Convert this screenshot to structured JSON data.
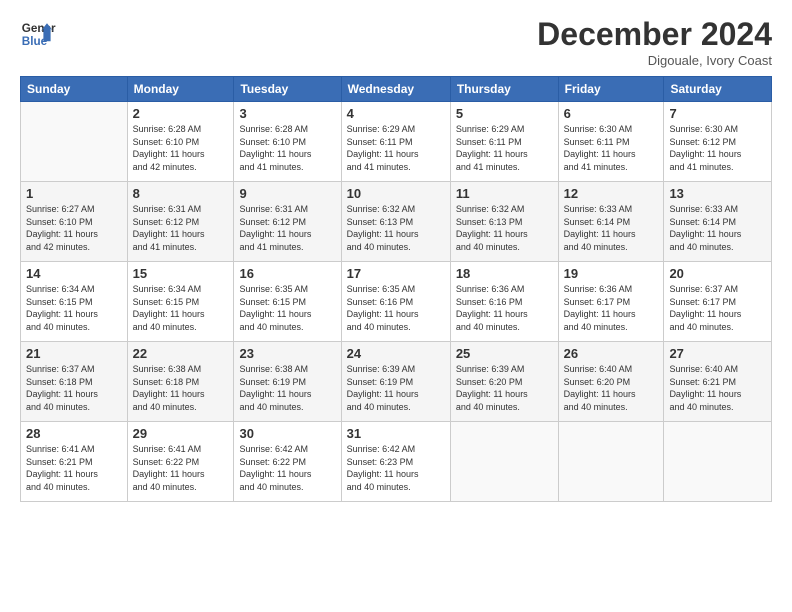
{
  "header": {
    "logo_line1": "General",
    "logo_line2": "Blue",
    "month_title": "December 2024",
    "location": "Digouale, Ivory Coast"
  },
  "calendar": {
    "headers": [
      "Sunday",
      "Monday",
      "Tuesday",
      "Wednesday",
      "Thursday",
      "Friday",
      "Saturday"
    ],
    "weeks": [
      [
        {
          "day": "",
          "info": ""
        },
        {
          "day": "2",
          "info": "Sunrise: 6:28 AM\nSunset: 6:10 PM\nDaylight: 11 hours\nand 42 minutes."
        },
        {
          "day": "3",
          "info": "Sunrise: 6:28 AM\nSunset: 6:10 PM\nDaylight: 11 hours\nand 41 minutes."
        },
        {
          "day": "4",
          "info": "Sunrise: 6:29 AM\nSunset: 6:11 PM\nDaylight: 11 hours\nand 41 minutes."
        },
        {
          "day": "5",
          "info": "Sunrise: 6:29 AM\nSunset: 6:11 PM\nDaylight: 11 hours\nand 41 minutes."
        },
        {
          "day": "6",
          "info": "Sunrise: 6:30 AM\nSunset: 6:11 PM\nDaylight: 11 hours\nand 41 minutes."
        },
        {
          "day": "7",
          "info": "Sunrise: 6:30 AM\nSunset: 6:12 PM\nDaylight: 11 hours\nand 41 minutes."
        }
      ],
      [
        {
          "day": "1",
          "info": "Sunrise: 6:27 AM\nSunset: 6:10 PM\nDaylight: 11 hours\nand 42 minutes."
        },
        {
          "day": "",
          "info": ""
        },
        {
          "day": "",
          "info": ""
        },
        {
          "day": "",
          "info": ""
        },
        {
          "day": "",
          "info": ""
        },
        {
          "day": "",
          "info": ""
        },
        {
          "day": "",
          "info": ""
        }
      ],
      [
        {
          "day": "8",
          "info": "Sunrise: 6:31 AM\nSunset: 6:12 PM\nDaylight: 11 hours\nand 41 minutes."
        },
        {
          "day": "9",
          "info": "Sunrise: 6:31 AM\nSunset: 6:12 PM\nDaylight: 11 hours\nand 41 minutes."
        },
        {
          "day": "10",
          "info": "Sunrise: 6:32 AM\nSunset: 6:13 PM\nDaylight: 11 hours\nand 40 minutes."
        },
        {
          "day": "11",
          "info": "Sunrise: 6:32 AM\nSunset: 6:13 PM\nDaylight: 11 hours\nand 40 minutes."
        },
        {
          "day": "12",
          "info": "Sunrise: 6:33 AM\nSunset: 6:14 PM\nDaylight: 11 hours\nand 40 minutes."
        },
        {
          "day": "13",
          "info": "Sunrise: 6:33 AM\nSunset: 6:14 PM\nDaylight: 11 hours\nand 40 minutes."
        },
        {
          "day": "14",
          "info": "Sunrise: 6:34 AM\nSunset: 6:15 PM\nDaylight: 11 hours\nand 40 minutes."
        }
      ],
      [
        {
          "day": "15",
          "info": "Sunrise: 6:34 AM\nSunset: 6:15 PM\nDaylight: 11 hours\nand 40 minutes."
        },
        {
          "day": "16",
          "info": "Sunrise: 6:35 AM\nSunset: 6:15 PM\nDaylight: 11 hours\nand 40 minutes."
        },
        {
          "day": "17",
          "info": "Sunrise: 6:35 AM\nSunset: 6:16 PM\nDaylight: 11 hours\nand 40 minutes."
        },
        {
          "day": "18",
          "info": "Sunrise: 6:36 AM\nSunset: 6:16 PM\nDaylight: 11 hours\nand 40 minutes."
        },
        {
          "day": "19",
          "info": "Sunrise: 6:36 AM\nSunset: 6:17 PM\nDaylight: 11 hours\nand 40 minutes."
        },
        {
          "day": "20",
          "info": "Sunrise: 6:37 AM\nSunset: 6:17 PM\nDaylight: 11 hours\nand 40 minutes."
        },
        {
          "day": "21",
          "info": "Sunrise: 6:37 AM\nSunset: 6:18 PM\nDaylight: 11 hours\nand 40 minutes."
        }
      ],
      [
        {
          "day": "22",
          "info": "Sunrise: 6:38 AM\nSunset: 6:18 PM\nDaylight: 11 hours\nand 40 minutes."
        },
        {
          "day": "23",
          "info": "Sunrise: 6:38 AM\nSunset: 6:19 PM\nDaylight: 11 hours\nand 40 minutes."
        },
        {
          "day": "24",
          "info": "Sunrise: 6:39 AM\nSunset: 6:19 PM\nDaylight: 11 hours\nand 40 minutes."
        },
        {
          "day": "25",
          "info": "Sunrise: 6:39 AM\nSunset: 6:20 PM\nDaylight: 11 hours\nand 40 minutes."
        },
        {
          "day": "26",
          "info": "Sunrise: 6:40 AM\nSunset: 6:20 PM\nDaylight: 11 hours\nand 40 minutes."
        },
        {
          "day": "27",
          "info": "Sunrise: 6:40 AM\nSunset: 6:21 PM\nDaylight: 11 hours\nand 40 minutes."
        },
        {
          "day": "28",
          "info": "Sunrise: 6:41 AM\nSunset: 6:21 PM\nDaylight: 11 hours\nand 40 minutes."
        }
      ],
      [
        {
          "day": "29",
          "info": "Sunrise: 6:41 AM\nSunset: 6:22 PM\nDaylight: 11 hours\nand 40 minutes."
        },
        {
          "day": "30",
          "info": "Sunrise: 6:42 AM\nSunset: 6:22 PM\nDaylight: 11 hours\nand 40 minutes."
        },
        {
          "day": "31",
          "info": "Sunrise: 6:42 AM\nSunset: 6:23 PM\nDaylight: 11 hours\nand 40 minutes."
        },
        {
          "day": "",
          "info": ""
        },
        {
          "day": "",
          "info": ""
        },
        {
          "day": "",
          "info": ""
        },
        {
          "day": "",
          "info": ""
        }
      ]
    ]
  }
}
